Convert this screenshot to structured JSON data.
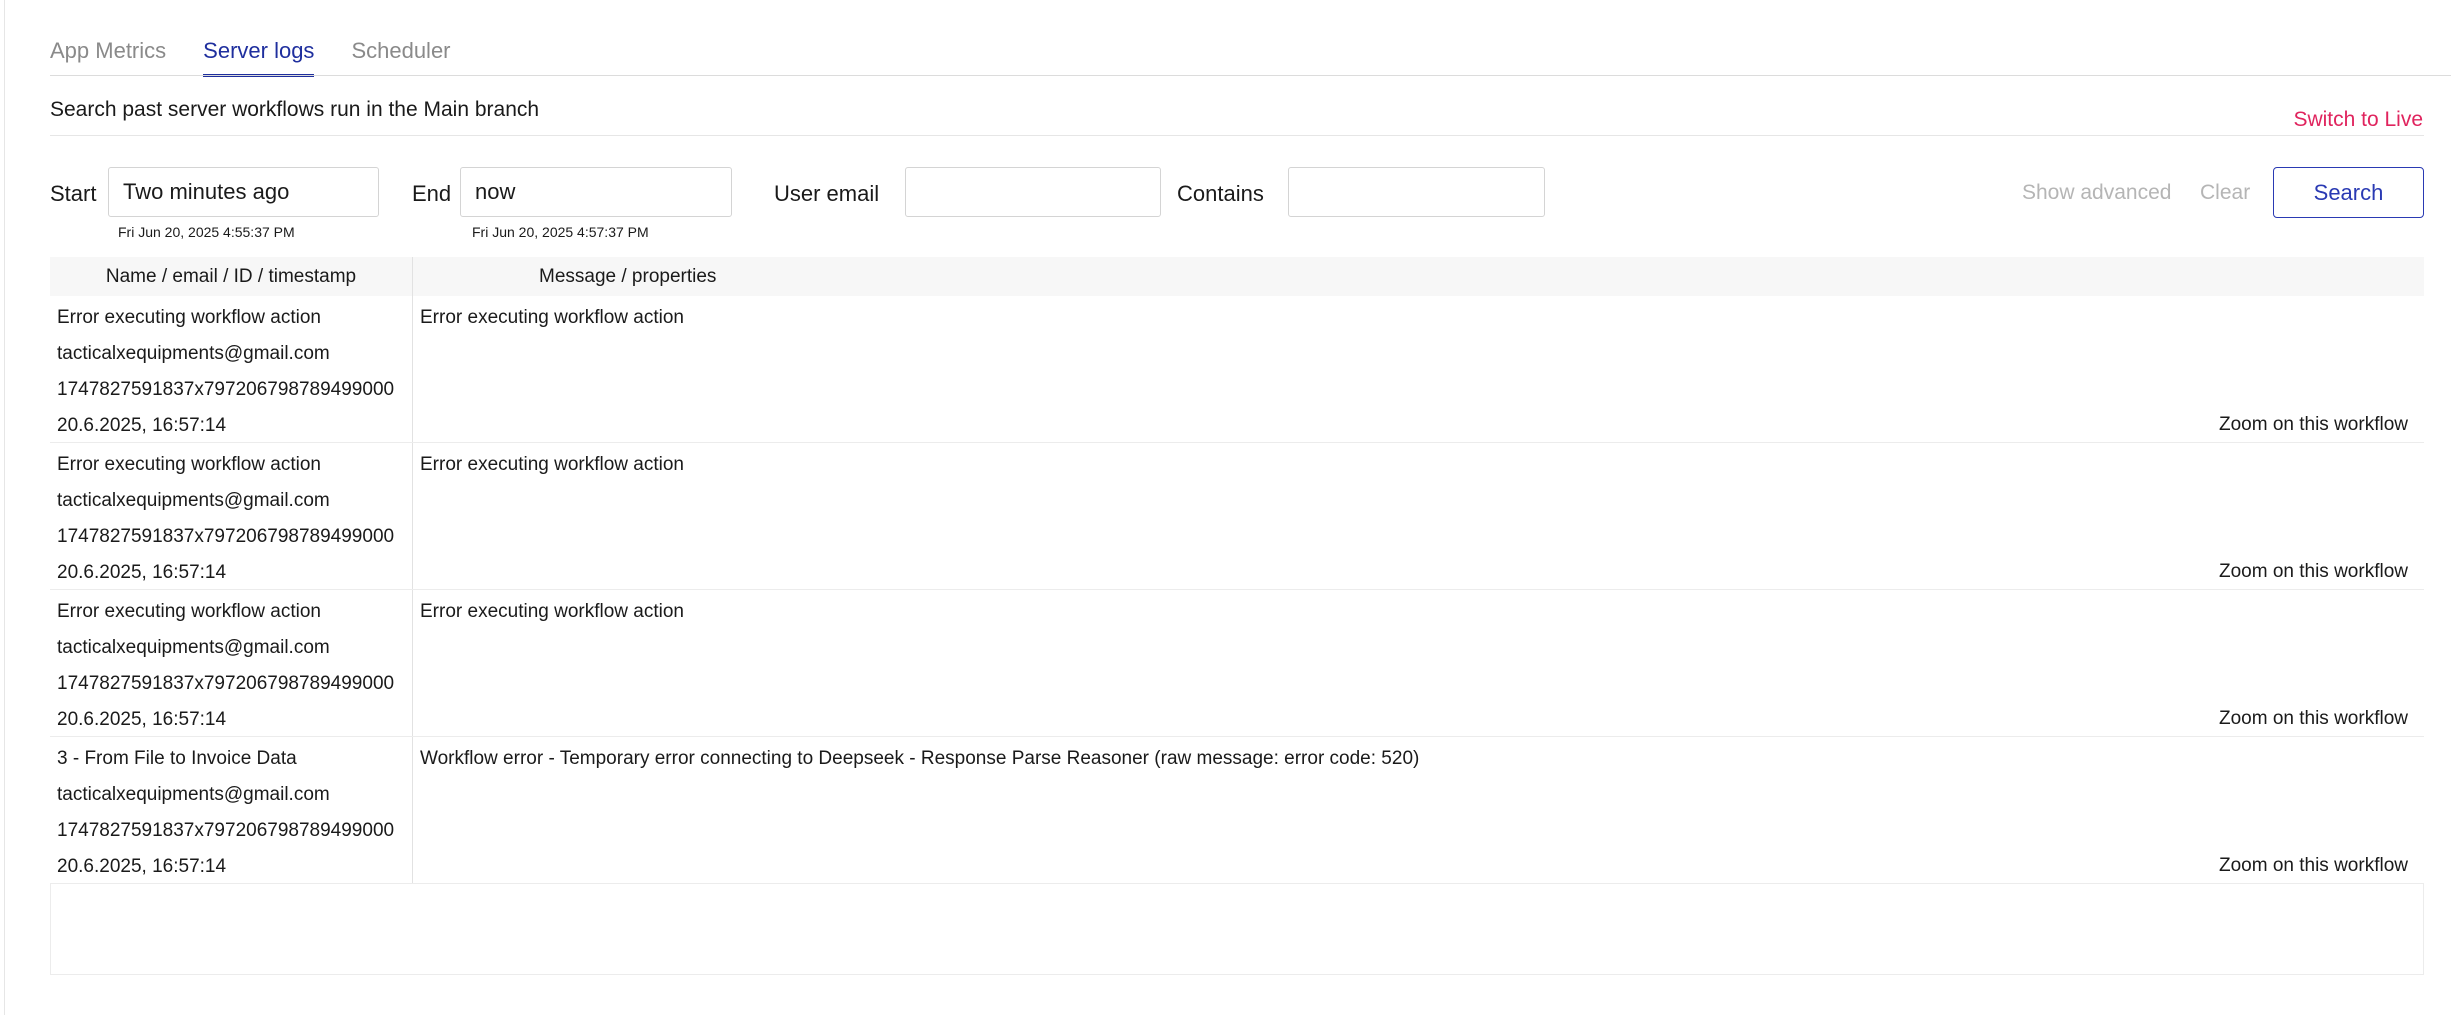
{
  "tabs": [
    {
      "label": "App Metrics",
      "active": false
    },
    {
      "label": "Server logs",
      "active": true
    },
    {
      "label": "Scheduler",
      "active": false
    }
  ],
  "subtitle": "Search past server workflows run in the Main branch",
  "switch_live": "Switch to Live",
  "filters": {
    "start_label": "Start",
    "start_value": "Two minutes ago",
    "start_hint": "Fri Jun 20, 2025 4:55:37 PM",
    "end_label": "End",
    "end_value": "now",
    "end_hint": "Fri Jun 20, 2025 4:57:37 PM",
    "email_label": "User email",
    "email_value": "",
    "contains_label": "Contains",
    "contains_value": ""
  },
  "actions": {
    "show_advanced": "Show advanced",
    "clear": "Clear",
    "search": "Search"
  },
  "table": {
    "headers": [
      "Name / email / ID / timestamp",
      "Message / properties"
    ],
    "zoom_label": "Zoom on this workflow",
    "rows": [
      {
        "name": "Error executing workflow action",
        "email": "tacticalxequipments@gmail.com",
        "id": "1747827591837x797206798789499000",
        "timestamp": "20.6.2025, 16:57:14",
        "message": "Error executing workflow action"
      },
      {
        "name": "Error executing workflow action",
        "email": "tacticalxequipments@gmail.com",
        "id": "1747827591837x797206798789499000",
        "timestamp": "20.6.2025, 16:57:14",
        "message": "Error executing workflow action"
      },
      {
        "name": "Error executing workflow action",
        "email": "tacticalxequipments@gmail.com",
        "id": "1747827591837x797206798789499000",
        "timestamp": "20.6.2025, 16:57:14",
        "message": "Error executing workflow action"
      },
      {
        "name": "3 - From File to Invoice Data",
        "email": "tacticalxequipments@gmail.com",
        "id": "1747827591837x797206798789499000",
        "timestamp": "20.6.2025, 16:57:14",
        "message": "Workflow error - Temporary error connecting to Deepseek - Response Parse Reasoner (raw message: error code: 520)"
      }
    ]
  }
}
